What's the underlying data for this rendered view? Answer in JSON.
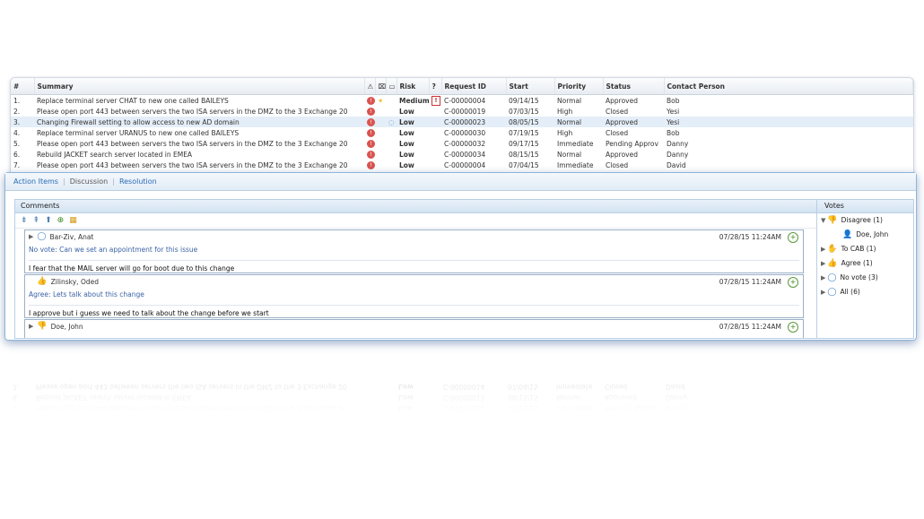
{
  "grid": {
    "headers": {
      "num": "#",
      "summary": "Summary",
      "c1": "⚠",
      "c2": "⌧",
      "c3": "▭",
      "risk": "Risk",
      "c4": "?",
      "request_id": "Request ID",
      "start": "Start",
      "priority": "Priority",
      "status": "Status",
      "contact": "Contact Person"
    },
    "rows": [
      {
        "num": "1.",
        "summary": "Replace terminal server CHAT to new one called BAILEYS",
        "risk": "Medium",
        "request_id": "C-00000004",
        "start": "09/14/15",
        "priority": "Normal",
        "status": "Approved",
        "contact": "Bob"
      },
      {
        "num": "2.",
        "summary": "Please open port 443 between servers the two ISA servers in the DMZ to the 3 Exchange 20",
        "risk": "Low",
        "request_id": "C-00000019",
        "start": "07/03/15",
        "priority": "High",
        "status": "Closed",
        "contact": "Yesi"
      },
      {
        "num": "3.",
        "summary": "Changing Firewall setting to allow access to new AD domain",
        "risk": "Low",
        "request_id": "C-00000023",
        "start": "08/05/15",
        "priority": "Normal",
        "status": "Approved",
        "contact": "Yesi"
      },
      {
        "num": "4.",
        "summary": "Replace terminal server URANUS to new one called BAILEYS",
        "risk": "Low",
        "request_id": "C-00000030",
        "start": "07/19/15",
        "priority": "High",
        "status": "Closed",
        "contact": "Bob"
      },
      {
        "num": "5.",
        "summary": "Please open port 443 between servers the two ISA servers in the DMZ to the 3 Exchange 20",
        "risk": "Low",
        "request_id": "C-00000032",
        "start": "09/17/15",
        "priority": "Immediate",
        "status": "Pending Approv",
        "contact": "Danny"
      },
      {
        "num": "6.",
        "summary": "Rebuild JACKET search server located in EMEA",
        "risk": "Low",
        "request_id": "C-00000034",
        "start": "08/15/15",
        "priority": "Normal",
        "status": "Approved",
        "contact": "Danny"
      },
      {
        "num": "7.",
        "summary": "Please open port 443 between servers the two ISA servers in the DMZ to the 3 Exchange 20",
        "risk": "Low",
        "request_id": "C-00000004",
        "start": "07/04/15",
        "priority": "Immediate",
        "status": "Closed",
        "contact": "David"
      }
    ],
    "reflection_rows": [
      {
        "num": "5.",
        "summary": "Please open port 443 between servers the two ISA servers in the DMZ to the 3 Exchange 20",
        "risk": "Low",
        "request_id": "C-00000012",
        "start": "09/17/15",
        "priority": "Immediate",
        "status": "Pending Approv",
        "contact": "Danny"
      },
      {
        "num": "6.",
        "summary": "Rebuild JACKET search server located in EMEA",
        "risk": "Low",
        "request_id": "C-00000013",
        "start": "08/15/15",
        "priority": "Normal",
        "status": "Approved",
        "contact": "Danny"
      },
      {
        "num": "7.",
        "summary": "Please open port 443 between servers the two ISA servers in the DMZ to the 3 Exchange 20",
        "risk": "Low",
        "request_id": "C-00000014",
        "start": "07/04/15",
        "priority": "Immediate",
        "status": "Closed",
        "contact": "David"
      }
    ]
  },
  "tabs": {
    "action_items": "Action Items",
    "discussion": "Discussion",
    "resolution": "Resolution",
    "sep": "|"
  },
  "comments": {
    "title": "Comments",
    "toolbar_icons": [
      "expand-all-icon",
      "collapse-all-icon",
      "up-icon",
      "add-comment-icon",
      "filter-icon"
    ],
    "items": [
      {
        "author": "Bar-Ziv, Anat",
        "date": "07/28/15 11:24AM",
        "vote": "No vote: Can we set an appointment for this issue",
        "text": "I fear that the MAIL server will go for boot due to this change"
      },
      {
        "author": "Zilinsky, Oded",
        "date": "07/28/15 11:24AM",
        "vote": "Agree: Lets talk about this change",
        "text": "I approve but i guess we need to talk about the change before we start"
      },
      {
        "author": "Doe, John",
        "date": "07/28/15 11:24AM"
      }
    ]
  },
  "votes": {
    "title": "Votes",
    "items": [
      {
        "label": "Disagree (1)",
        "expanded": true
      },
      {
        "label": "Doe, John",
        "child": true
      },
      {
        "label": "To CAB (1)"
      },
      {
        "label": "Agree (1)"
      },
      {
        "label": "No vote (3)"
      },
      {
        "label": "All (6)"
      }
    ]
  },
  "colors": {
    "accent": "#2a6bb8",
    "risk_low": "#3a9a2a",
    "risk_medium": "#d9a21b",
    "badge": "#d9534f",
    "border": "#8fb4d8"
  }
}
